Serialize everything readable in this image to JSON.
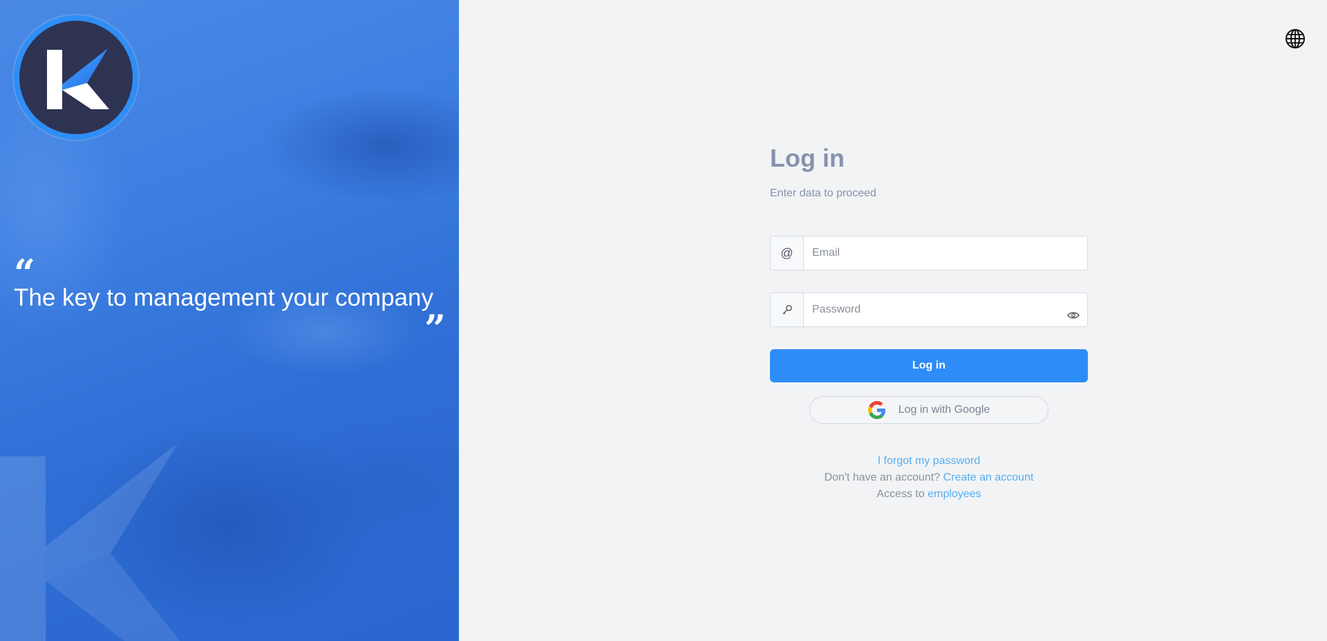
{
  "hero": {
    "quote_open": "“",
    "quote_text": "The key to management your company",
    "quote_close": "”"
  },
  "header": {
    "language_icon": "globe-icon"
  },
  "form": {
    "title": "Log in",
    "subtitle": "Enter data to proceed",
    "email": {
      "icon": "at-icon",
      "placeholder": "Email",
      "value": ""
    },
    "password": {
      "icon": "key-icon",
      "placeholder": "Password",
      "value": "",
      "toggle_icon": "eye-icon"
    },
    "submit_label": "Log in",
    "google_label": "Log in with Google"
  },
  "links": {
    "forgot": "I forgot my password",
    "no_account_prefix": "Don't have an account?",
    "create_account": "Create an account",
    "access_prefix": "Access to",
    "employees": "employees"
  },
  "colors": {
    "primary": "#2e8cf8",
    "hero_blue": "#3b7de0",
    "logo_navy": "#2e3352",
    "link": "#56aef0",
    "muted_text": "#8693aa"
  }
}
